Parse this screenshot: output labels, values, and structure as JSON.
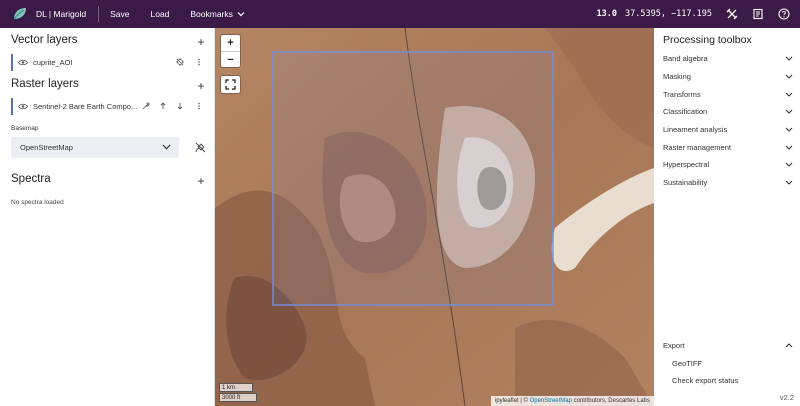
{
  "app": {
    "title": "DL | Marigold"
  },
  "menu": {
    "save": "Save",
    "load": "Load",
    "bookmarks": "Bookmarks"
  },
  "readout": {
    "zoom": "13.0",
    "coords": "37.5395, −117.1953"
  },
  "icons": {
    "logo": "marigold-logo-icon",
    "topbar": [
      "tools-crossed-icon",
      "notes-icon",
      "help-icon"
    ],
    "layer_visibility": "eye-icon",
    "layer_zoom": "crosshair-off-icon",
    "layer_settings": "wrench-icon",
    "move_up": "arrow-up-icon",
    "move_down": "arrow-down-icon",
    "more": "more-vertical-icon",
    "basemap_toggle": "satellite-off-icon"
  },
  "vector_layers": {
    "header": "Vector layers",
    "items": [
      {
        "name": "cuprite_AOI"
      }
    ]
  },
  "raster_layers": {
    "header": "Raster layers",
    "items": [
      {
        "name": "Sentinel-2 Bare Earth Compo..."
      }
    ]
  },
  "basemap": {
    "label": "Basemap",
    "value": "OpenStreetMap"
  },
  "spectra": {
    "header": "Spectra",
    "empty": "No spectra loaded"
  },
  "map": {
    "zoom_in": "+",
    "zoom_out": "−",
    "scale_metric": "1 km",
    "scale_imperial": "3000 ft",
    "attribution_prefix": "ipyleaflet | © ",
    "attribution_link": "OpenStreetMap",
    "attribution_suffix": " contributors, Descartes Labs"
  },
  "toolbox": {
    "title": "Processing toolbox",
    "items": [
      "Band algebra",
      "Masking",
      "Transforms",
      "Classification",
      "Lineament analysis",
      "Raster management",
      "Hyperspectral",
      "Sustainability"
    ]
  },
  "export": {
    "title": "Export",
    "items": [
      "GeoTIFF",
      "Check export status"
    ]
  },
  "version": "v2.2",
  "colors": {
    "topbar": "#3b1a47",
    "layer_accent": "#5b6fb3",
    "aoi_outline": "#6f8fe0"
  }
}
